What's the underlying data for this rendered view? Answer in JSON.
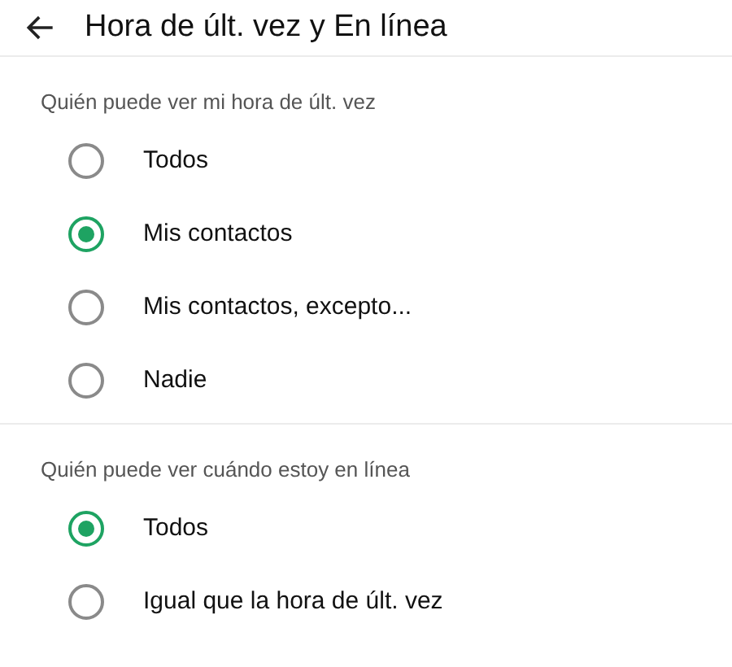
{
  "header": {
    "title": "Hora de últ. vez y En línea"
  },
  "sections": [
    {
      "title": "Quién puede ver mi hora de últ. vez",
      "options": [
        {
          "label": "Todos",
          "selected": false
        },
        {
          "label": "Mis contactos",
          "selected": true
        },
        {
          "label": "Mis contactos, excepto...",
          "selected": false
        },
        {
          "label": "Nadie",
          "selected": false
        }
      ]
    },
    {
      "title": "Quién puede ver cuándo estoy en línea",
      "options": [
        {
          "label": "Todos",
          "selected": true
        },
        {
          "label": "Igual que la hora de últ. vez",
          "selected": false
        }
      ]
    }
  ]
}
